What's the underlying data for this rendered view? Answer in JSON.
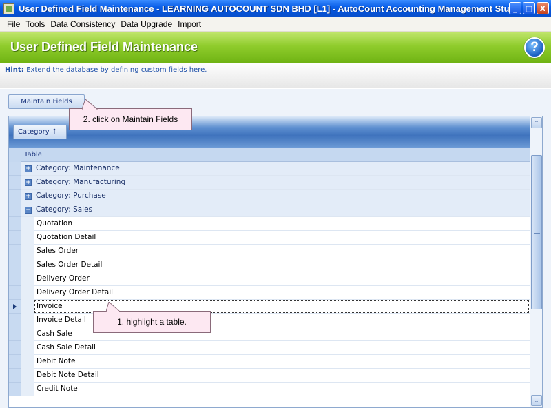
{
  "window": {
    "title": "User Defined Field Maintenance - LEARNING AUTOCOUNT SDN BHD [L1] - AutoCount Accounting Management Stu...",
    "minimize_label": "_",
    "maximize_label": "□",
    "close_label": "X"
  },
  "menu": [
    "File",
    "Tools",
    "Data Consistency",
    "Data Upgrade",
    "Import"
  ],
  "header": {
    "title": "User Defined Field Maintenance",
    "help_glyph": "?"
  },
  "hint": {
    "label": "Hint:",
    "text": "Extend the database by defining custom fields here."
  },
  "toolbar": {
    "maintain_fields_label": "Maintain Fields"
  },
  "grid": {
    "group_chip_label": "Category ↑",
    "column_header": "Table",
    "groups": [
      {
        "label": "Category: Maintenance",
        "expanded": false
      },
      {
        "label": "Category: Manufacturing",
        "expanded": false
      },
      {
        "label": "Category: Purchase",
        "expanded": false
      },
      {
        "label": "Category: Sales",
        "expanded": true
      }
    ],
    "expand_glyph": "+",
    "collapse_glyph": "−",
    "sales_rows": [
      "Quotation",
      "Quotation Detail",
      "Sales Order",
      "Sales Order Detail",
      "Delivery Order",
      "Delivery Order Detail",
      "Invoice",
      "Invoice Detail",
      "Cash Sale",
      "Cash Sale Detail",
      "Debit Note",
      "Debit Note Detail",
      "Credit Note"
    ],
    "selected_row": "Invoice"
  },
  "callouts": {
    "step2": "2. click on Maintain Fields",
    "step1": "1. highlight a table."
  },
  "scrollbar": {
    "up_glyph": "⌃",
    "down_glyph": "⌄"
  }
}
